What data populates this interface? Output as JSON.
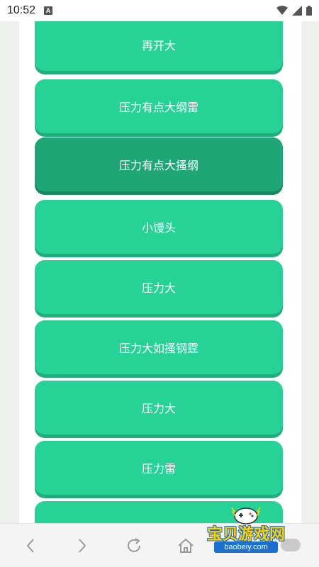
{
  "status_bar": {
    "time": "10:52",
    "notification_icon": "a-icon",
    "icons": [
      "wifi-icon",
      "signal-icon",
      "battery-icon"
    ]
  },
  "buttons": [
    {
      "label": "再开大",
      "active": false
    },
    {
      "label": "压力有点大纲雷",
      "active": false
    },
    {
      "label": "压力有点大搔纲",
      "active": true
    },
    {
      "label": "小馒头",
      "active": false
    },
    {
      "label": "压力大",
      "active": false
    },
    {
      "label": "压力大如搔钢霆",
      "active": false
    },
    {
      "label": "压力大",
      "active": false
    },
    {
      "label": "压力雷",
      "active": false
    },
    {
      "label": "",
      "active": false
    }
  ],
  "nav_bar": {
    "icons": [
      "back-icon",
      "forward-icon",
      "refresh-icon",
      "home-icon",
      "toggle-switch"
    ]
  },
  "watermark": {
    "title": "宝贝游戏网",
    "url": "baobeiy.com"
  },
  "colors": {
    "button": "#27d297",
    "button_active": "#1fa677",
    "button_shadow": "#1fae7c",
    "background": "#eef0ee"
  }
}
